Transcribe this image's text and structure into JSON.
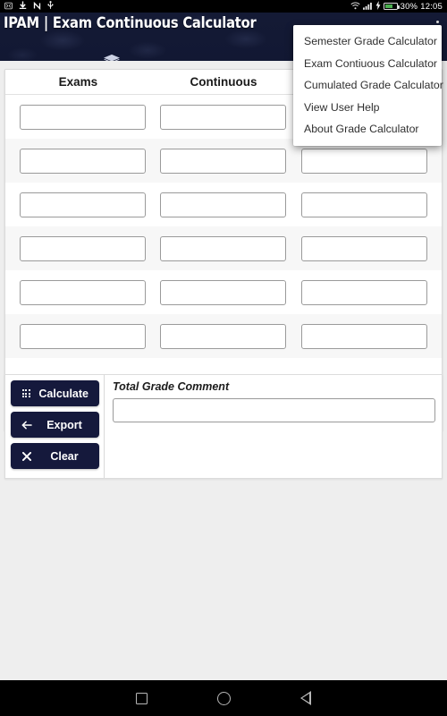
{
  "status_bar": {
    "left_icons": [
      "screenshot-icon",
      "download-icon",
      "nfc-icon",
      "usb-icon"
    ],
    "battery_percent": "30%",
    "time": "12:05",
    "signal_icon": "wifi-icon",
    "cellular_icon": "cellular-signal-icon",
    "charging_icon": "charging-bolt-icon"
  },
  "app_bar": {
    "title": "IPAM | Exam Continuous Calculator",
    "overflow_menu_icon": "overflow-menu-icon",
    "accent_color": "#5ed4cb",
    "background_color": "#141a35"
  },
  "tabs": [
    {
      "icon": "layers-icon",
      "active": true
    },
    {
      "icon": "book-icon",
      "active": false
    }
  ],
  "menu": {
    "items": [
      {
        "label": "Semester Grade Calculator"
      },
      {
        "label": "Exam Contiuous Calculator"
      },
      {
        "label": "Cumulated Grade Calculator"
      },
      {
        "label": "View User Help"
      },
      {
        "label": "About Grade Calculator"
      }
    ]
  },
  "table": {
    "headers": [
      "Exams",
      "Continuous",
      ""
    ],
    "rows": [
      {
        "exams": "",
        "continuous": "",
        "third": ""
      },
      {
        "exams": "",
        "continuous": "",
        "third": ""
      },
      {
        "exams": "",
        "continuous": "",
        "third": ""
      },
      {
        "exams": "",
        "continuous": "",
        "third": ""
      },
      {
        "exams": "",
        "continuous": "",
        "third": ""
      },
      {
        "exams": "",
        "continuous": "",
        "third": ""
      }
    ]
  },
  "actions": {
    "calculate_label": "Calculate",
    "calculate_icon": "grid-icon",
    "export_label": "Export",
    "export_icon": "arrow-left-icon",
    "clear_label": "Clear",
    "clear_icon": "close-x-icon",
    "button_color": "#15193c"
  },
  "comment": {
    "label": "Total Grade Comment",
    "value": "",
    "placeholder": ""
  },
  "nav_bar": {
    "recents_icon": "square-recents-icon",
    "home_icon": "circle-home-icon",
    "back_icon": "triangle-back-icon"
  }
}
